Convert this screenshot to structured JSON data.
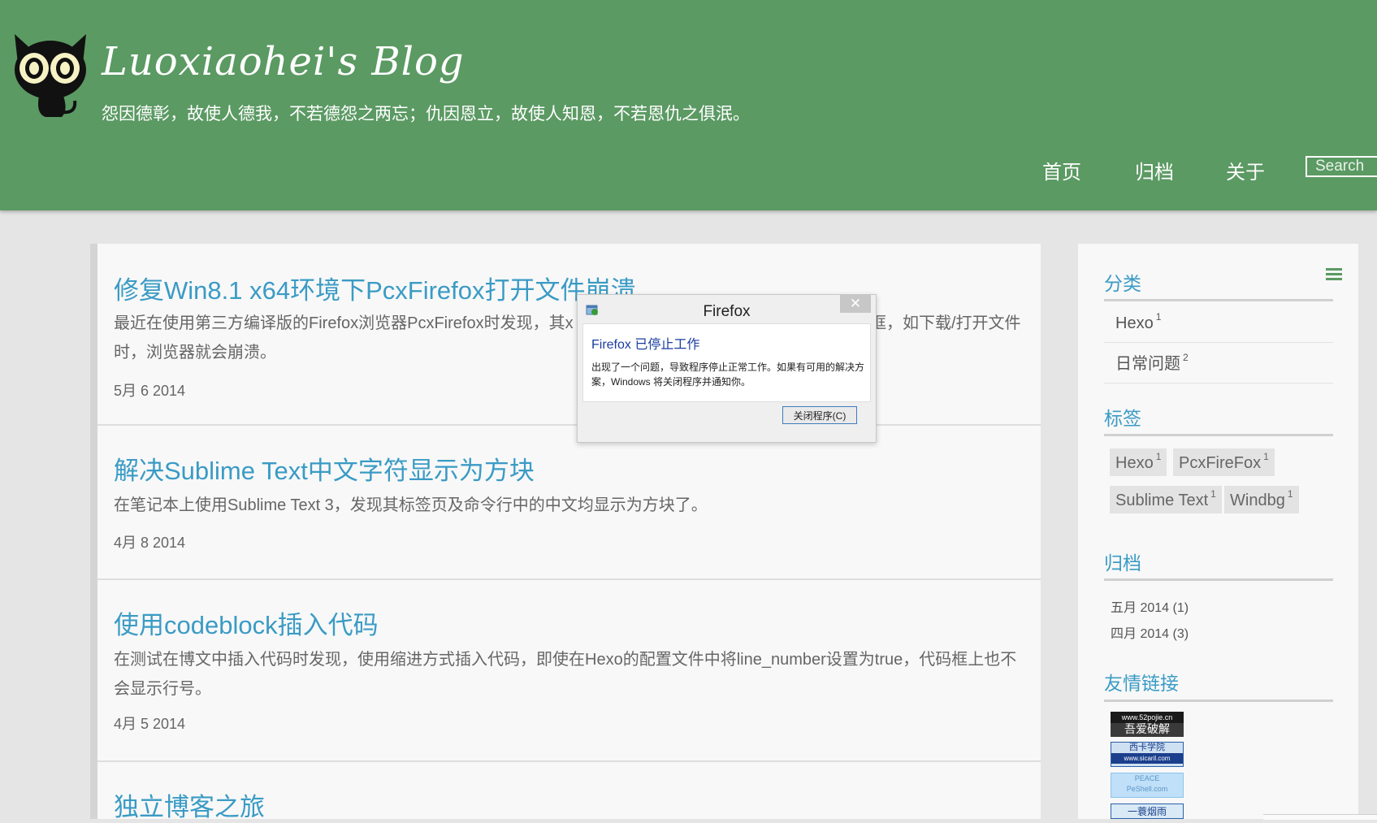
{
  "header": {
    "site_title": "Luoxiaohei's Blog",
    "subtitle": "怨因德彰，故使人德我，不若德怨之两忘；仇因恩立，故使人知恩，不若恩仇之俱泯。",
    "nav": [
      "首页",
      "归档",
      "关于"
    ],
    "search_placeholder": "Search"
  },
  "posts": [
    {
      "title": "修复Win8.1 x64环境下PcxFirefox打开文件崩溃",
      "excerpt_before": "最近在使用第三方编译版的Firefox浏览器PcxFirefox时发现，其x",
      "excerpt_after": "框，如下载/打开文件",
      "excerpt_line2": "时，浏览器就会崩溃。",
      "date": "5月 6 2014"
    },
    {
      "title": "解决Sublime Text中文字符显示为方块",
      "excerpt": "在笔记本上使用Sublime Text 3，发现其标签页及命令行中的中文均显示为方块了。",
      "date": "4月 8 2014"
    },
    {
      "title": "使用codeblock插入代码",
      "excerpt": "在测试在博文中插入代码时发现，使用缩进方式插入代码，即使在Hexo的配置文件中将line_number设置为true，代码框上也不会显示行号。",
      "date": "4月 5 2014"
    },
    {
      "title": "独立博客之旅"
    }
  ],
  "sidebar": {
    "categories_heading": "分类",
    "categories": [
      {
        "name": "Hexo",
        "count": "1"
      },
      {
        "name": "日常问题",
        "count": "2"
      }
    ],
    "tags_heading": "标签",
    "tags": [
      {
        "name": "Hexo",
        "count": "1"
      },
      {
        "name": "PcxFireFox",
        "count": "1"
      },
      {
        "name": "Sublime Text",
        "count": "1"
      },
      {
        "name": "Windbg",
        "count": "1"
      }
    ],
    "archive_heading": "归档",
    "archives": [
      "五月 2014  (1)",
      "四月 2014  (3)"
    ],
    "links_heading": "友情链接",
    "links": [
      {
        "line1": "www.52pojie.cn",
        "line2": "吾爱破解"
      },
      {
        "line1": "西卡学院",
        "line2": "www.sicaril.com"
      },
      {
        "line1": "PEACE",
        "line2": "PeShell.com"
      },
      {
        "line1": "一蓑烟雨",
        "line2": ""
      }
    ]
  },
  "dialog": {
    "window_title": "Firefox",
    "close_glyph": "✕",
    "heading": "Firefox 已停止工作",
    "message": "出现了一个问题，导致程序停止正常工作。如果有可用的解决方案，Windows 将关闭程序并通知你。",
    "button": "关闭程序(C)"
  },
  "colors": {
    "header_bg": "#5b9a63",
    "link": "#3a9bc5",
    "page_bg": "#e5e5e5"
  },
  "icons": [
    "cat-logo-icon",
    "menu-icon",
    "firefox-error-icon",
    "close-icon"
  ]
}
